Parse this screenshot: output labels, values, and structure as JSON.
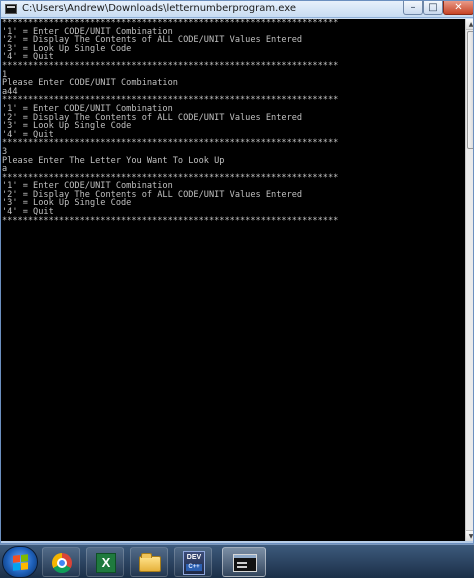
{
  "window": {
    "title": "C:\\Users\\Andrew\\Downloads\\letternumberprogram.exe",
    "controls": {
      "minimize_glyph": "–",
      "maximize_glyph": "□",
      "close_glyph": "✕"
    }
  },
  "console": {
    "background": "#000000",
    "text_color": "#c0c0c0",
    "lines": [
      "*****************************************************************",
      "'1' = Enter CODE/UNIT Combination",
      "'2' = Display The Contents of ALL CODE/UNIT Values Entered",
      "'3' = Look Up Single Code",
      "'4' = Quit",
      "*****************************************************************",
      "1",
      "Please Enter CODE/UNIT Combination",
      "a44",
      "*****************************************************************",
      "'1' = Enter CODE/UNIT Combination",
      "'2' = Display The Contents of ALL CODE/UNIT Values Entered",
      "'3' = Look Up Single Code",
      "'4' = Quit",
      "*****************************************************************",
      "3",
      "Please Enter The Letter You Want To Look Up",
      "a",
      "*****************************************************************",
      "'1' = Enter CODE/UNIT Combination",
      "'2' = Display The Contents of ALL CODE/UNIT Values Entered",
      "'3' = Look Up Single Code",
      "'4' = Quit",
      "*****************************************************************"
    ]
  },
  "scrollbar": {
    "up_glyph": "▲",
    "down_glyph": "▼",
    "position_fraction": 0.0
  },
  "taskbar": {
    "items": [
      {
        "name": "start-button-icon",
        "icon": "windows-logo-icon"
      },
      {
        "name": "chrome",
        "icon": "chrome-icon"
      },
      {
        "name": "excel",
        "icon": "excel-icon",
        "label": "X"
      },
      {
        "name": "explorer",
        "icon": "folder-icon"
      },
      {
        "name": "devcpp",
        "icon": "devcpp-icon",
        "label": "DEV",
        "sublabel": "C++"
      },
      {
        "name": "console",
        "icon": "console-window-icon",
        "active": true
      }
    ]
  }
}
